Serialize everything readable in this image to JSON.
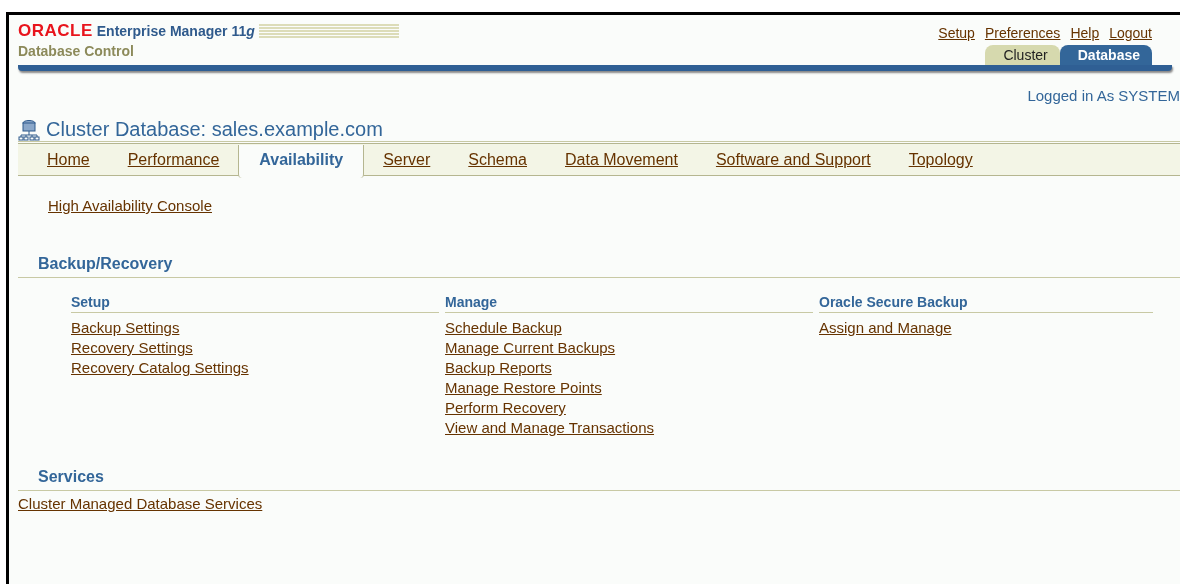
{
  "brand": {
    "logo": "ORACLE",
    "product": "Enterprise Manager 11",
    "product_suffix": "g",
    "subtitle": "Database Control"
  },
  "global_links": [
    "Setup",
    "Preferences",
    "Help",
    "Logout"
  ],
  "brand_tabs": [
    {
      "label": "Cluster",
      "selected": false
    },
    {
      "label": "Database",
      "selected": true
    }
  ],
  "logged_in": "Logged in As SYSTEM",
  "page_title": "Cluster Database: sales.example.com",
  "tabs": [
    {
      "label": "Home",
      "selected": false
    },
    {
      "label": "Performance",
      "selected": false
    },
    {
      "label": "Availability",
      "selected": true
    },
    {
      "label": "Server",
      "selected": false
    },
    {
      "label": "Schema",
      "selected": false
    },
    {
      "label": "Data Movement",
      "selected": false
    },
    {
      "label": "Software and Support",
      "selected": false
    },
    {
      "label": "Topology",
      "selected": false
    }
  ],
  "top_link": "High Availability Console",
  "sections": [
    {
      "title": "Backup/Recovery",
      "columns": [
        {
          "title": "Setup",
          "links": [
            "Backup Settings",
            "Recovery Settings",
            "Recovery Catalog Settings"
          ]
        },
        {
          "title": "Manage",
          "links": [
            "Schedule Backup",
            "Manage Current Backups",
            "Backup Reports",
            "Manage Restore Points",
            "Perform Recovery",
            "View and Manage Transactions"
          ]
        },
        {
          "title": "Oracle Secure Backup",
          "links": [
            "Assign and Manage"
          ]
        }
      ]
    },
    {
      "title": "Services",
      "links": [
        "Cluster Managed Database Services"
      ]
    }
  ]
}
